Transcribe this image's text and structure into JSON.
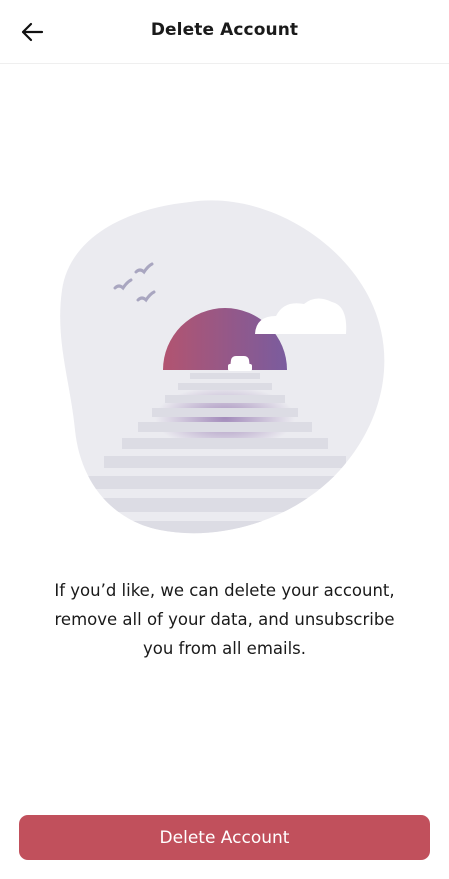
{
  "header": {
    "title": "Delete Account",
    "back_icon": "arrow-left-icon"
  },
  "illustration": {
    "description_icon": "sunset-road-car-illustration"
  },
  "message": {
    "lines": [
      "If you’d like, we can delete your account,",
      "remove all of your data, and unsubscribe",
      "you from all emails."
    ]
  },
  "actions": {
    "delete_label": "Delete Account"
  },
  "colors": {
    "accent": "#c1505c",
    "blob": "#ebebf0",
    "sun_start": "#b25470",
    "sun_end": "#7a5c9e"
  }
}
